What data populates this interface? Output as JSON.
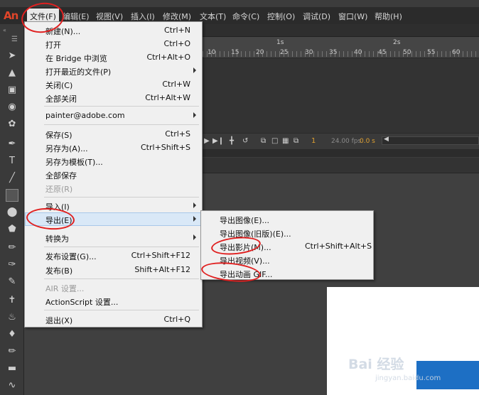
{
  "app": {
    "logo": "An"
  },
  "menubar": [
    {
      "label": "文件(F)"
    },
    {
      "label": "编辑(E)"
    },
    {
      "label": "视图(V)"
    },
    {
      "label": "插入(I)"
    },
    {
      "label": "修改(M)"
    },
    {
      "label": "文本(T)"
    },
    {
      "label": "命令(C)"
    },
    {
      "label": "控制(O)"
    },
    {
      "label": "调试(D)"
    },
    {
      "label": "窗口(W)"
    },
    {
      "label": "帮助(H)"
    }
  ],
  "file_menu": {
    "items": [
      {
        "label": "新建(N)...",
        "shortcut": "Ctrl+N"
      },
      {
        "label": "打开",
        "shortcut": "Ctrl+O"
      },
      {
        "label": "在 Bridge 中浏览",
        "shortcut": "Ctrl+Alt+O"
      },
      {
        "label": "打开最近的文件(P)",
        "shortcut": ""
      },
      {
        "label": "关闭(C)",
        "shortcut": "Ctrl+W"
      },
      {
        "label": "全部关闭",
        "shortcut": "Ctrl+Alt+W"
      },
      {
        "label": "painter@adobe.com",
        "shortcut": ""
      },
      {
        "label": "保存(S)",
        "shortcut": "Ctrl+S"
      },
      {
        "label": "另存为(A)...",
        "shortcut": "Ctrl+Shift+S"
      },
      {
        "label": "另存为模板(T)...",
        "shortcut": ""
      },
      {
        "label": "全部保存",
        "shortcut": ""
      },
      {
        "label": "还原(R)",
        "shortcut": ""
      },
      {
        "label": "导入(I)",
        "shortcut": ""
      },
      {
        "label": "导出(E)",
        "shortcut": ""
      },
      {
        "label": "转换为",
        "shortcut": ""
      },
      {
        "label": "发布设置(G)...",
        "shortcut": "Ctrl+Shift+F12"
      },
      {
        "label": "发布(B)",
        "shortcut": "Shift+Alt+F12"
      },
      {
        "label": "AIR 设置...",
        "shortcut": ""
      },
      {
        "label": "ActionScript 设置...",
        "shortcut": ""
      },
      {
        "label": "退出(X)",
        "shortcut": "Ctrl+Q"
      }
    ]
  },
  "export_submenu": {
    "items": [
      {
        "label": "导出图像(E)...",
        "shortcut": ""
      },
      {
        "label": "导出图像(旧版)(E)...",
        "shortcut": ""
      },
      {
        "label": "导出影片(M)...",
        "shortcut": "Ctrl+Shift+Alt+S"
      },
      {
        "label": "导出视频(V)...",
        "shortcut": ""
      },
      {
        "label": "导出动画 GIF...",
        "shortcut": ""
      }
    ]
  },
  "timeline": {
    "ruler_seconds": [
      "1s",
      "2s"
    ],
    "ruler_frames": [
      "10",
      "15",
      "20",
      "25",
      "30",
      "35",
      "40",
      "45",
      "50",
      "55",
      "60"
    ],
    "current_frame": "1",
    "fps": "24.00 fps",
    "time": "0.0 s"
  },
  "watermark": {
    "text": "Bai 经验",
    "url": "jingyan.baidu.com"
  },
  "colors": {
    "accent_logo": "#e0452a",
    "annotation": "#e02020",
    "highlight": "#d9e8f7"
  }
}
